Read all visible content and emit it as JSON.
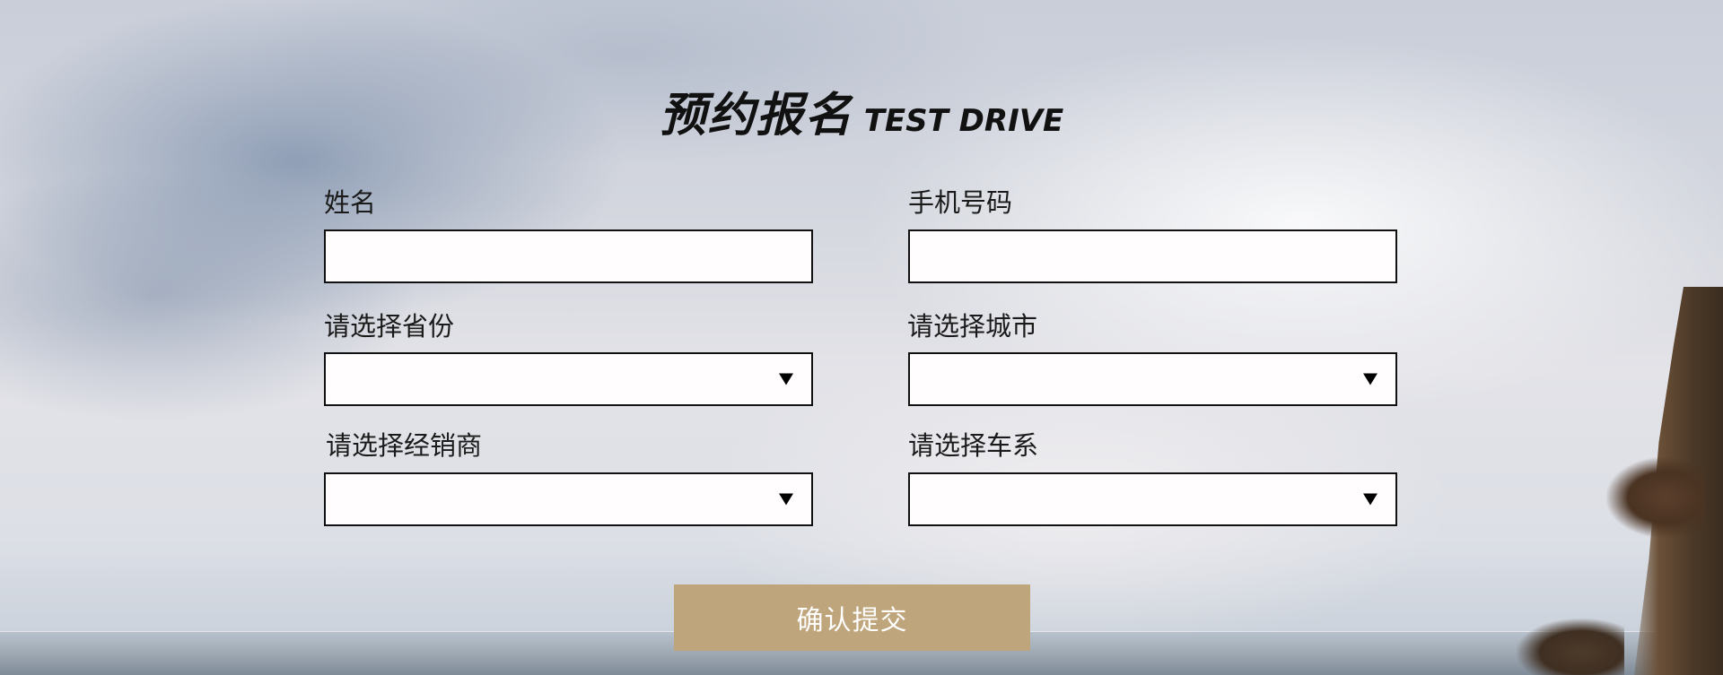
{
  "title": {
    "cn": "预约报名",
    "en": "TEST DRIVE"
  },
  "form": {
    "name": {
      "label": "姓名",
      "value": ""
    },
    "phone": {
      "label": "手机号码",
      "value": ""
    },
    "province": {
      "label": "请选择省份",
      "selected": ""
    },
    "city": {
      "label": "请选择城市",
      "selected": ""
    },
    "dealer": {
      "label": "请选择经销商",
      "selected": ""
    },
    "series": {
      "label": "请选择车系",
      "selected": ""
    }
  },
  "submit": {
    "label": "确认提交"
  },
  "colors": {
    "submit_bg": "#bfa57c",
    "field_border": "#111111",
    "field_bg": "#fffdfd"
  },
  "icons": {
    "dropdown": "caret-down-icon"
  }
}
